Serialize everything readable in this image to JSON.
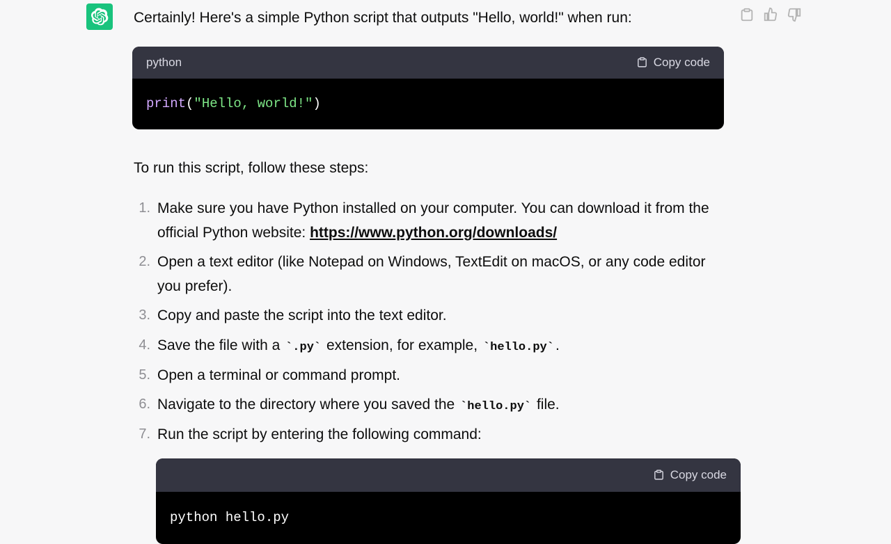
{
  "message": {
    "intro": "Certainly! Here's a simple Python script that outputs \"Hello, world!\" when run:",
    "code1": {
      "language": "python",
      "copy_label": "Copy code",
      "tokens": {
        "func": "print",
        "open": "(",
        "str": "\"Hello, world!\"",
        "close": ")"
      }
    },
    "steps_intro": "To run this script, follow these steps:",
    "steps": {
      "s1a": "Make sure you have Python installed on your computer. You can download it from the official Python website: ",
      "s1_link": "https://www.python.org/downloads/",
      "s2": "Open a text editor (like Notepad on Windows, TextEdit on macOS, or any code editor you prefer).",
      "s3": "Copy and paste the script into the text editor.",
      "s4a": "Save the file with a ",
      "s4_code1": "`.py`",
      "s4b": " extension, for example, ",
      "s4_code2": "`hello.py`",
      "s4c": ".",
      "s5": "Open a terminal or command prompt.",
      "s6a": "Navigate to the directory where you saved the ",
      "s6_code": "`hello.py`",
      "s6b": " file.",
      "s7": "Run the script by entering the following command:"
    },
    "code2": {
      "copy_label": "Copy code",
      "body": "python hello.py"
    }
  },
  "icons": {
    "copy_tip": "Copy",
    "like_tip": "Good response",
    "dislike_tip": "Bad response"
  }
}
